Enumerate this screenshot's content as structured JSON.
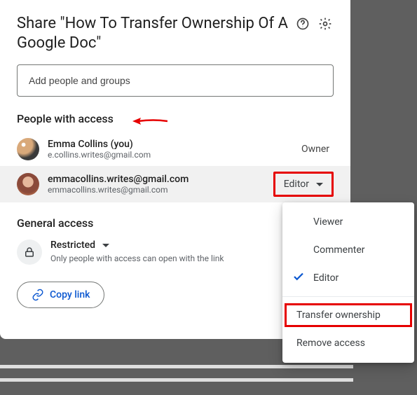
{
  "dialog": {
    "title": "Share \"How To Transfer Ownership Of A Google Doc\"",
    "addPlaceholder": "Add people and groups"
  },
  "sections": {
    "peopleLabel": "People with access",
    "generalLabel": "General access"
  },
  "people": [
    {
      "name": "Emma Collins (you)",
      "email": "e.collins.writes@gmail.com",
      "role": "Owner"
    },
    {
      "name": "emmacollins.writes@gmail.com",
      "email": "emmacollins.writes@gmail.com",
      "role": "Editor"
    }
  ],
  "general": {
    "name": "Restricted",
    "desc": "Only people with access can open with the link"
  },
  "copyLink": "Copy link",
  "menu": {
    "viewer": "Viewer",
    "commenter": "Commenter",
    "editor": "Editor",
    "transfer": "Transfer ownership",
    "remove": "Remove access"
  }
}
